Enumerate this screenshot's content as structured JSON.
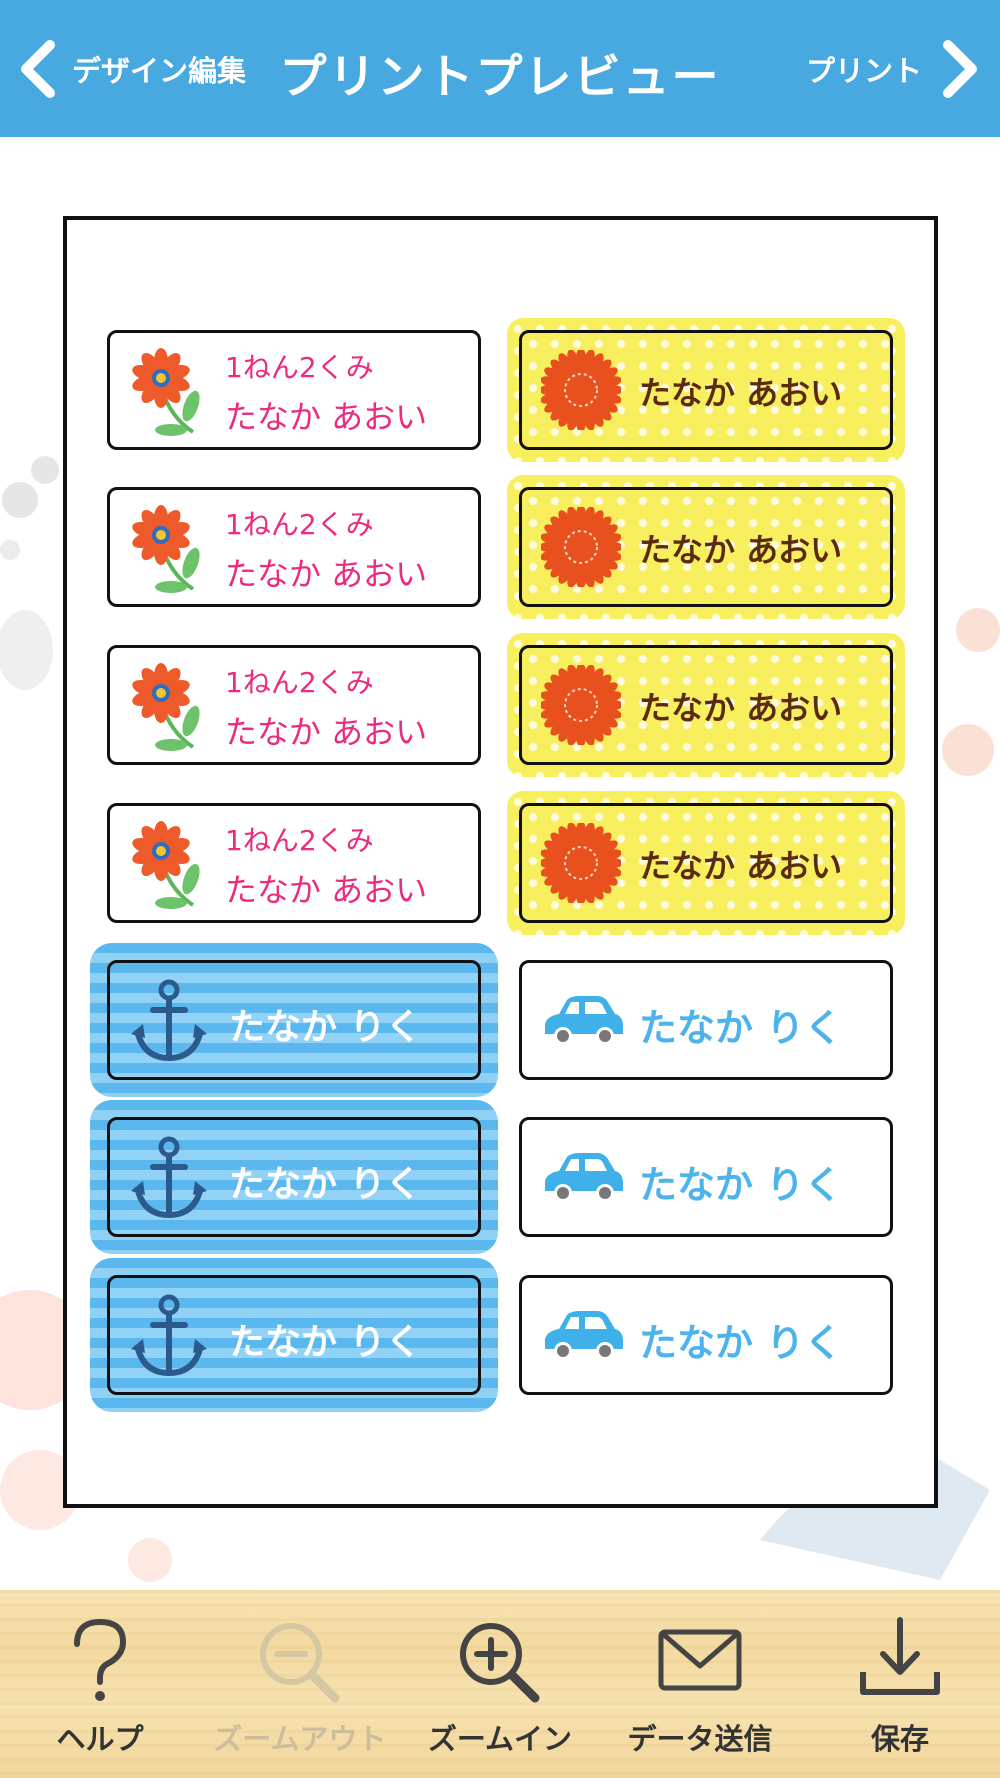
{
  "header": {
    "back_label": "デザイン編集",
    "title": "プリントプレビュー",
    "print_label": "プリント",
    "back_icon": "chevron-left-icon",
    "print_icon": "chevron-right-icon",
    "color": "#48a8e0"
  },
  "labels": {
    "flower": [
      {
        "line1": "1ねん2くみ",
        "line2": "たなか あおい"
      },
      {
        "line1": "1ねん2くみ",
        "line2": "たなか あおい"
      },
      {
        "line1": "1ねん2くみ",
        "line2": "たなか あおい"
      },
      {
        "line1": "1ねん2くみ",
        "line2": "たなか あおい"
      }
    ],
    "sun": [
      {
        "name": "たなか あおい"
      },
      {
        "name": "たなか あおい"
      },
      {
        "name": "たなか あおい"
      },
      {
        "name": "たなか あおい"
      }
    ],
    "anchor": [
      {
        "name": "たなか りく"
      },
      {
        "name": "たなか りく"
      },
      {
        "name": "たなか りく"
      }
    ],
    "car": [
      {
        "name": "たなか りく"
      },
      {
        "name": "たなか りく"
      },
      {
        "name": "たなか りく"
      }
    ]
  },
  "toolbar": {
    "items": [
      {
        "label": "ヘルプ",
        "icon": "help-icon",
        "enabled": true
      },
      {
        "label": "ズームアウト",
        "icon": "zoom-out-icon",
        "enabled": false
      },
      {
        "label": "ズームイン",
        "icon": "zoom-in-icon",
        "enabled": true
      },
      {
        "label": "データ送信",
        "icon": "mail-icon",
        "enabled": true
      },
      {
        "label": "保存",
        "icon": "download-icon",
        "enabled": true
      }
    ]
  }
}
